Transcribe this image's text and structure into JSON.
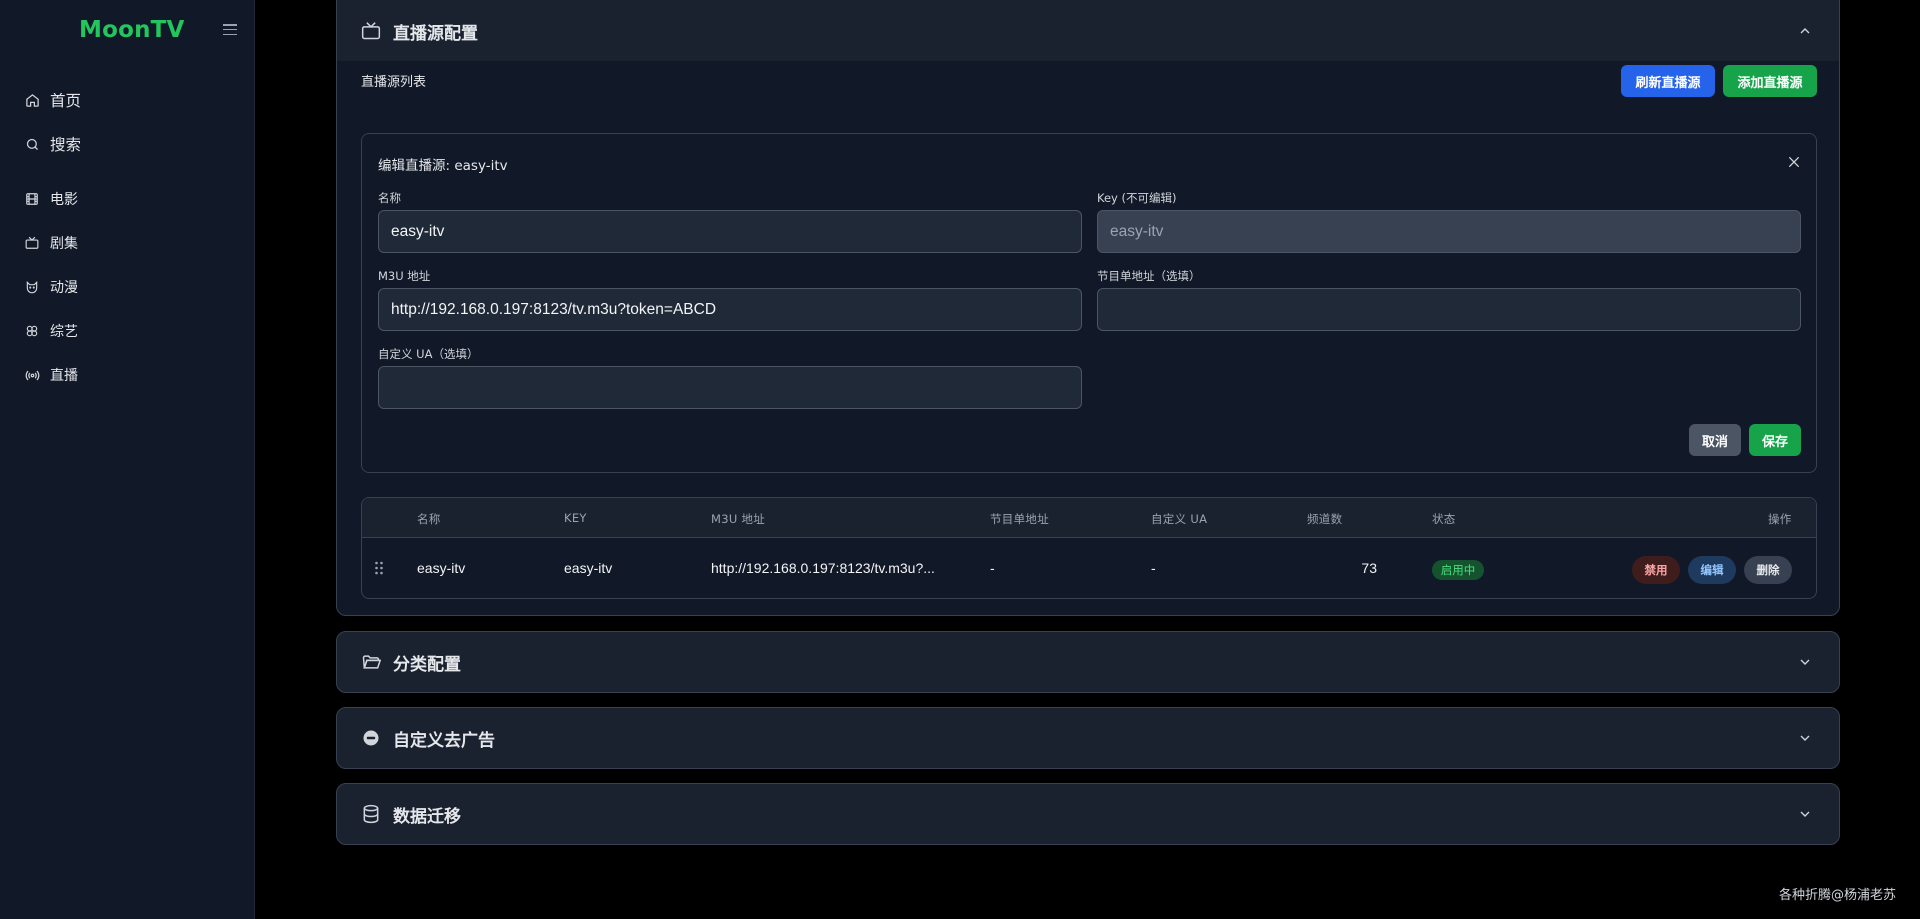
{
  "sidebar": {
    "logo": "MoonTV",
    "items": [
      {
        "label": "首页",
        "icon": "home-icon"
      },
      {
        "label": "搜索",
        "icon": "search-icon"
      },
      {
        "label": "电影",
        "icon": "film-icon"
      },
      {
        "label": "剧集",
        "icon": "tv-icon"
      },
      {
        "label": "动漫",
        "icon": "cat-icon"
      },
      {
        "label": "综艺",
        "icon": "clover-icon"
      },
      {
        "label": "直播",
        "icon": "radio-icon"
      }
    ]
  },
  "live_panel": {
    "title": "直播源配置",
    "list_title": "直播源列表",
    "refresh_label": "刷新直播源",
    "add_label": "添加直播源",
    "edit": {
      "title": "编辑直播源: easy-itv",
      "name_label": "名称",
      "name_value": "easy-itv",
      "key_label": "Key (不可编辑)",
      "key_value": "easy-itv",
      "m3u_label": "M3U 地址",
      "m3u_value": "http://192.168.0.197:8123/tv.m3u?token=ABCD",
      "epg_label": "节目单地址（选填）",
      "epg_value": "",
      "ua_label": "自定义 UA（选填）",
      "ua_value": "",
      "cancel_label": "取消",
      "save_label": "保存"
    },
    "table": {
      "headers": [
        "名称",
        "KEY",
        "M3U 地址",
        "节目单地址",
        "自定义 UA",
        "频道数",
        "状态",
        "操作"
      ],
      "rows": [
        {
          "name": "easy-itv",
          "key": "easy-itv",
          "m3u": "http://192.168.0.197:8123/tv.m3u?...",
          "epg": "-",
          "ua": "-",
          "channels": "73",
          "status": "启用中",
          "disable_label": "禁用",
          "edit_label": "编辑",
          "delete_label": "删除"
        }
      ]
    }
  },
  "sections": [
    {
      "title": "分类配置",
      "icon": "folder-open-icon"
    },
    {
      "title": "自定义去广告",
      "icon": "minus-circle-icon"
    },
    {
      "title": "数据迁移",
      "icon": "database-icon"
    }
  ],
  "footer": "各种折腾@杨浦老苏",
  "colors": {
    "accent": "#22c55e",
    "primary": "#2563eb",
    "success": "#16a34a",
    "danger_bg": "#3f1d1d",
    "danger_text": "#fca5a5"
  }
}
